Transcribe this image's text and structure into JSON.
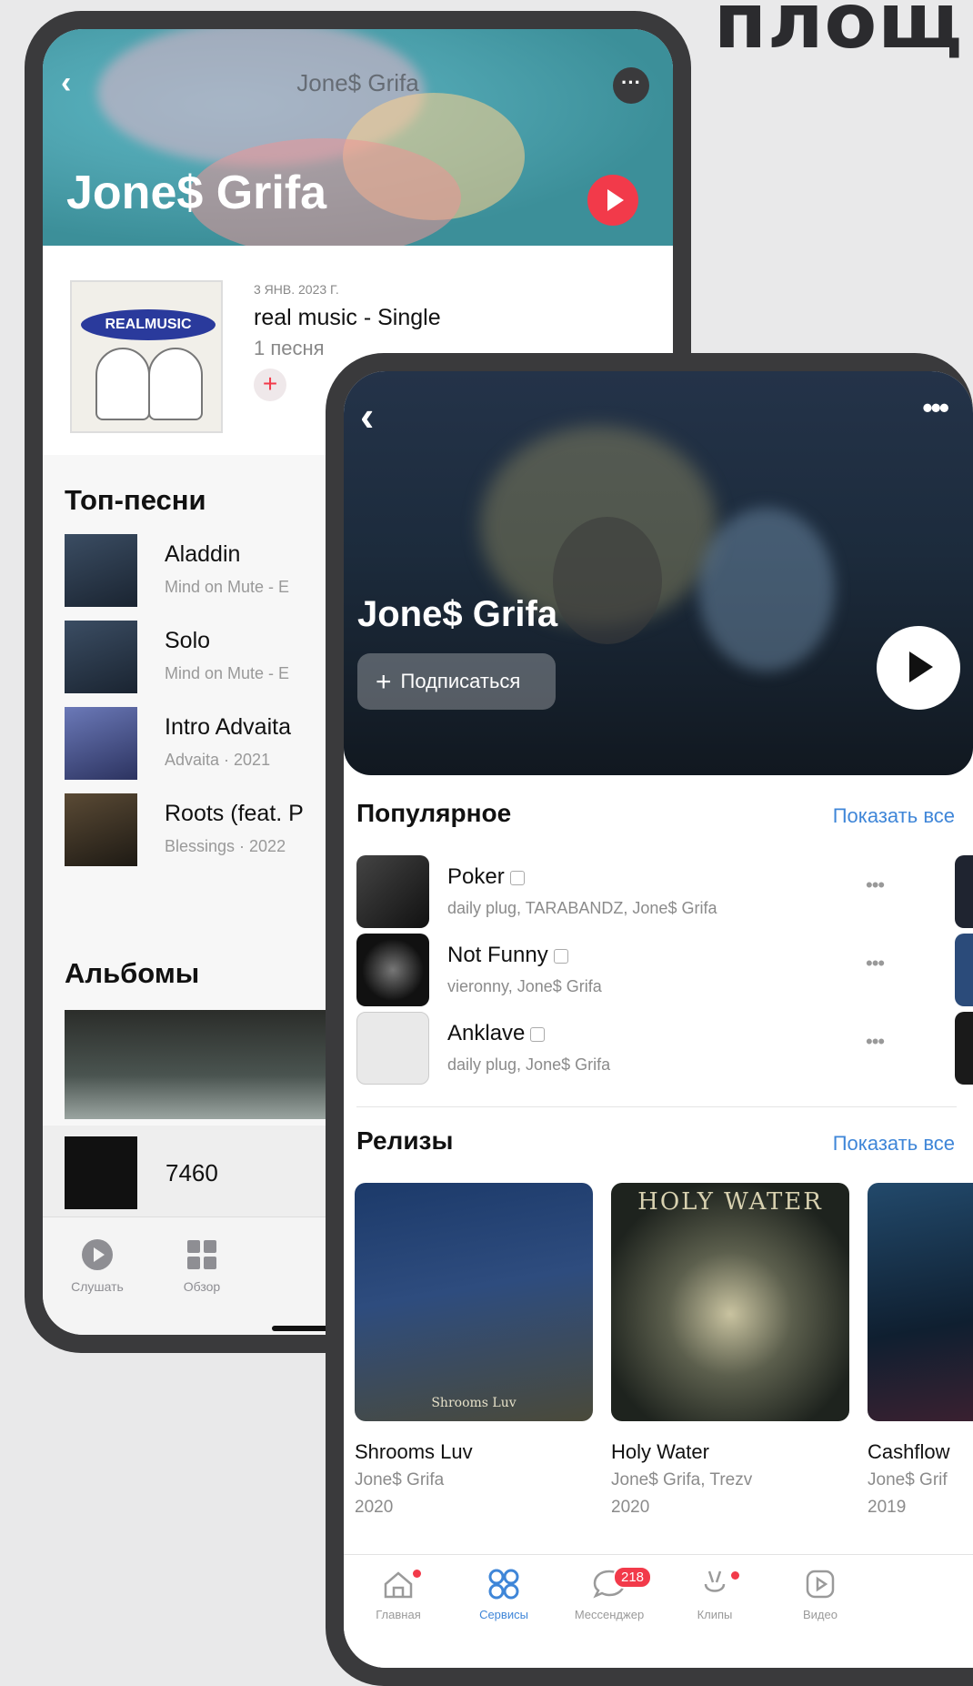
{
  "headline": "площ",
  "back_app": {
    "header_title": "Jone$ Grifa",
    "artist": "Jone$ Grifa",
    "latest": {
      "date": "3 ЯНВ. 2023 Г.",
      "title": "real music - Single",
      "count": "1 песня",
      "cover_text": "REALMUSIC"
    },
    "top_songs_heading": "Топ-песни",
    "top_songs": [
      {
        "title": "Aladdin",
        "subtitle": "Mind on Mute - E"
      },
      {
        "title": "Solo",
        "subtitle": "Mind on Mute - E"
      },
      {
        "title": "Intro Advaita",
        "subtitle": "Advaita · 2021"
      },
      {
        "title": "Roots (feat. P",
        "subtitle": "Blessings · 2022"
      }
    ],
    "albums_heading": "Альбомы",
    "now_playing": "7460",
    "tabs": [
      {
        "label": "Слушать",
        "icon": "play-circle-icon"
      },
      {
        "label": "Обзор",
        "icon": "grid-icon"
      }
    ]
  },
  "front_app": {
    "artist": "Jone$ Grifa",
    "subscribe_label": "Подписаться",
    "popular_heading": "Популярное",
    "show_all": "Показать все",
    "tracks": [
      {
        "title": "Poker",
        "artists": "daily plug, TARABANDZ, Jone$ Grifa"
      },
      {
        "title": "Not Funny",
        "artists": "vieronny, Jone$ Grifa"
      },
      {
        "title": "Anklave",
        "artists": "daily plug, Jone$ Grifa"
      }
    ],
    "releases_heading": "Релизы",
    "releases": [
      {
        "title": "Shrooms Luv",
        "artist": "Jone$ Grifa",
        "year": "2020"
      },
      {
        "title": "Holy Water",
        "artist": "Jone$ Grifa, Trezv",
        "year": "2020"
      },
      {
        "title": "Cashflow",
        "artist": "Jone$ Grif",
        "year": "2019"
      }
    ],
    "cover_texts": {
      "holy_water": "HOLY WATER",
      "shrooms": "Shrooms Luv"
    },
    "tabs": [
      {
        "label": "Главная",
        "icon": "home-icon"
      },
      {
        "label": "Сервисы",
        "icon": "services-icon"
      },
      {
        "label": "Мессенджер",
        "icon": "chat-icon",
        "badge": "218"
      },
      {
        "label": "Клипы",
        "icon": "clips-icon"
      },
      {
        "label": "Видео",
        "icon": "video-icon"
      }
    ],
    "accent": "#3f86d8",
    "badge_color": "#f23a4a"
  }
}
